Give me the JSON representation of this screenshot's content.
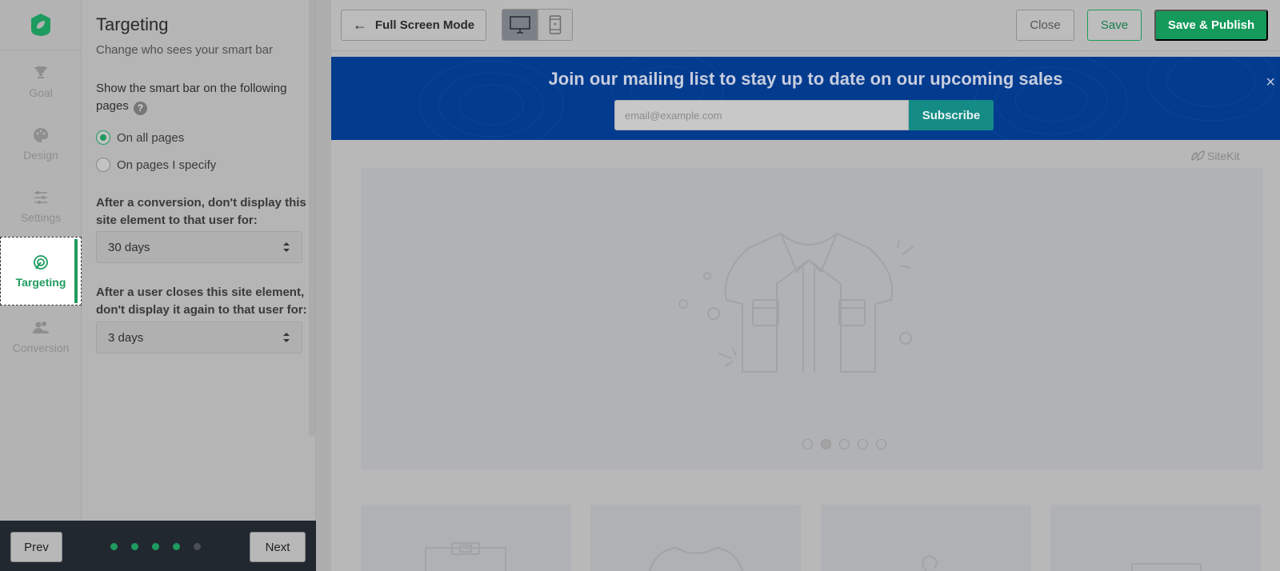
{
  "nav": {
    "items": [
      {
        "label": "Goal",
        "icon": "trophy-icon"
      },
      {
        "label": "Design",
        "icon": "palette-icon"
      },
      {
        "label": "Settings",
        "icon": "sliders-icon"
      },
      {
        "label": "Targeting",
        "icon": "target-icon",
        "active": true
      },
      {
        "label": "Conversion",
        "icon": "users-icon"
      }
    ]
  },
  "panel": {
    "title": "Targeting",
    "subtitle": "Change who sees your smart bar",
    "pages_question": "Show the smart bar on the following pages",
    "help": "?",
    "options": [
      {
        "label": "On all pages",
        "selected": true
      },
      {
        "label": "On pages I specify",
        "selected": false
      }
    ],
    "conversion_label": "After a conversion, don't display this site element to that user for:",
    "conversion_value": "30 days",
    "close_label": "After a user closes this site element, don't display it again to that user for:",
    "close_value": "3 days"
  },
  "stepper": {
    "prev": "Prev",
    "next": "Next",
    "total_steps": 5,
    "completed_steps": 4
  },
  "toolbar": {
    "fullscreen": "Full Screen Mode",
    "close": "Close",
    "save": "Save",
    "publish": "Save & Publish"
  },
  "smartbar": {
    "headline": "Join our mailing list to stay up to date on our upcoming sales",
    "placeholder": "email@example.com",
    "button": "Subscribe",
    "close": "×"
  },
  "site": {
    "brand": "SiteKit",
    "slides": 5,
    "current_slide": 2
  },
  "colors": {
    "accent": "#1e9b5f",
    "smartbar_bg": "#033b8f",
    "subscribe_bg": "#158b86",
    "stepper_bg": "#222830"
  }
}
